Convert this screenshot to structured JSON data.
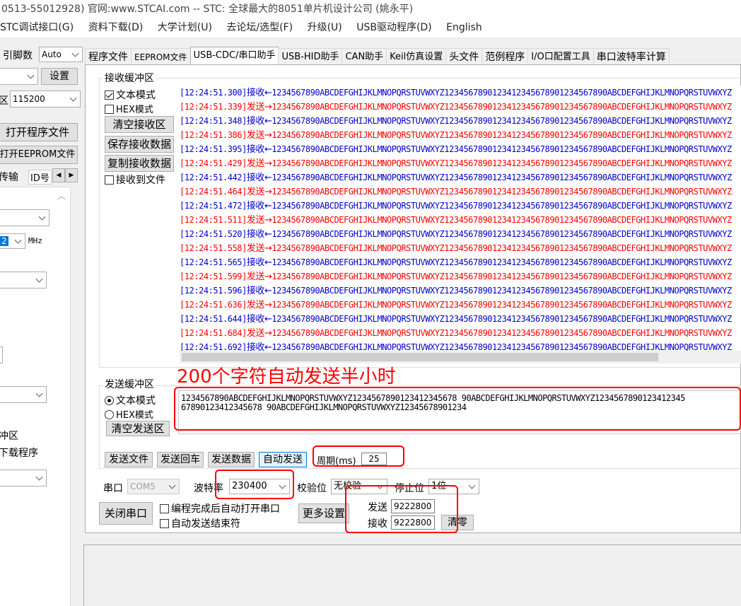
{
  "window": {
    "title": "0513-55012928) 官网:www.STCAI.com  -- STC: 全球最大的8051单片机设计公司 (姚永平)"
  },
  "menu": [
    "STC调试接口(G)",
    "资料下载(D)",
    "大学计划(U)",
    "去论坛/选型(F)",
    "升级(U)",
    "USB驱动程序(D)",
    "English"
  ],
  "left": {
    "pin_label": "引脚数",
    "pin_value": "Auto",
    "settings_button": "设置",
    "baud_prefix": "区",
    "baud_value": "115200",
    "open_program_button": "打开程序文件",
    "open_eeprom_button": "打开EEPROM文件",
    "subtab_transfer": "传输",
    "subtab_id": "ID号",
    "freq_value": "2",
    "freq_unit": "MHz",
    "item_zone": "冲区",
    "item_download": "下载程序"
  },
  "tabs": [
    "程序文件",
    "EEPROM文件",
    "USB-CDC/串口助手",
    "USB-HID助手",
    "CAN助手",
    "Keil仿真设置",
    "头文件",
    "范例程序",
    "I/O口配置工具",
    "串口波特率计算"
  ],
  "active_tab": 2,
  "receive": {
    "group_title": "接收缓冲区",
    "text_mode": "文本模式",
    "hex_mode": "HEX模式",
    "clear_button": "清空接收区",
    "save_button": "保存接收数据",
    "copy_button": "复制接收数据",
    "to_file": "接收到文件",
    "lines": [
      {
        "time": "[12:24:51.300]",
        "dir": "rx",
        "tag": "接收←",
        "data": "1234567890ABCDEFGHIJKLMNOPQRSTUVWXYZ1234567890123412345678901234567890ABCDEFGHIJKLMNOPQRSTUVWXYZ"
      },
      {
        "time": "[12:24:51.339]",
        "dir": "tx",
        "tag": "发送→",
        "data": "1234567890ABCDEFGHIJKLMNOPQRSTUVWXYZ1234567890123412345678901234567890ABCDEFGHIJKLMNOPQRSTUVWXYZ"
      },
      {
        "time": "[12:24:51.348]",
        "dir": "rx",
        "tag": "接收←",
        "data": "1234567890ABCDEFGHIJKLMNOPQRSTUVWXYZ1234567890123412345678901234567890ABCDEFGHIJKLMNOPQRSTUVWXYZ"
      },
      {
        "time": "[12:24:51.386]",
        "dir": "tx",
        "tag": "发送→",
        "data": "1234567890ABCDEFGHIJKLMNOPQRSTUVWXYZ1234567890123412345678901234567890ABCDEFGHIJKLMNOPQRSTUVWXYZ"
      },
      {
        "time": "[12:24:51.395]",
        "dir": "rx",
        "tag": "接收←",
        "data": "1234567890ABCDEFGHIJKLMNOPQRSTUVWXYZ1234567890123412345678901234567890ABCDEFGHIJKLMNOPQRSTUVWXYZ"
      },
      {
        "time": "[12:24:51.429]",
        "dir": "tx",
        "tag": "发送→",
        "data": "1234567890ABCDEFGHIJKLMNOPQRSTUVWXYZ1234567890123412345678901234567890ABCDEFGHIJKLMNOPQRSTUVWXYZ"
      },
      {
        "time": "[12:24:51.442]",
        "dir": "rx",
        "tag": "接收←",
        "data": "1234567890ABCDEFGHIJKLMNOPQRSTUVWXYZ1234567890123412345678901234567890ABCDEFGHIJKLMNOPQRSTUVWXYZ"
      },
      {
        "time": "[12:24:51.464]",
        "dir": "tx",
        "tag": "发送→",
        "data": "1234567890ABCDEFGHIJKLMNOPQRSTUVWXYZ1234567890123412345678901234567890ABCDEFGHIJKLMNOPQRSTUVWXYZ"
      },
      {
        "time": "[12:24:51.472]",
        "dir": "rx",
        "tag": "接收←",
        "data": "1234567890ABCDEFGHIJKLMNOPQRSTUVWXYZ1234567890123412345678901234567890ABCDEFGHIJKLMNOPQRSTUVWXYZ"
      },
      {
        "time": "[12:24:51.511]",
        "dir": "tx",
        "tag": "发送→",
        "data": "1234567890ABCDEFGHIJKLMNOPQRSTUVWXYZ1234567890123412345678901234567890ABCDEFGHIJKLMNOPQRSTUVWXYZ"
      },
      {
        "time": "[12:24:51.520]",
        "dir": "rx",
        "tag": "接收←",
        "data": "1234567890ABCDEFGHIJKLMNOPQRSTUVWXYZ1234567890123412345678901234567890ABCDEFGHIJKLMNOPQRSTUVWXYZ"
      },
      {
        "time": "[12:24:51.558]",
        "dir": "tx",
        "tag": "发送→",
        "data": "1234567890ABCDEFGHIJKLMNOPQRSTUVWXYZ1234567890123412345678901234567890ABCDEFGHIJKLMNOPQRSTUVWXYZ"
      },
      {
        "time": "[12:24:51.565]",
        "dir": "rx",
        "tag": "接收←",
        "data": "1234567890ABCDEFGHIJKLMNOPQRSTUVWXYZ1234567890123412345678901234567890ABCDEFGHIJKLMNOPQRSTUVWXYZ"
      },
      {
        "time": "[12:24:51.599]",
        "dir": "tx",
        "tag": "发送→",
        "data": "1234567890ABCDEFGHIJKLMNOPQRSTUVWXYZ1234567890123412345678901234567890ABCDEFGHIJKLMNOPQRSTUVWXYZ"
      },
      {
        "time": "[12:24:51.596]",
        "dir": "rx",
        "tag": "接收←",
        "data": "1234567890ABCDEFGHIJKLMNOPQRSTUVWXYZ1234567890123412345678901234567890ABCDEFGHIJKLMNOPQRSTUVWXYZ"
      },
      {
        "time": "[12:24:51.636]",
        "dir": "tx",
        "tag": "发送→",
        "data": "1234567890ABCDEFGHIJKLMNOPQRSTUVWXYZ1234567890123412345678901234567890ABCDEFGHIJKLMNOPQRSTUVWXYZ"
      },
      {
        "time": "[12:24:51.644]",
        "dir": "rx",
        "tag": "接收←",
        "data": "1234567890ABCDEFGHIJKLMNOPQRSTUVWXYZ1234567890123412345678901234567890ABCDEFGHIJKLMNOPQRSTUVWXYZ"
      },
      {
        "time": "[12:24:51.684]",
        "dir": "tx",
        "tag": "发送→",
        "data": "1234567890ABCDEFGHIJKLMNOPQRSTUVWXYZ1234567890123412345678901234567890ABCDEFGHIJKLMNOPQRSTUVWXYZ"
      },
      {
        "time": "[12:24:51.692]",
        "dir": "rx",
        "tag": "接收←",
        "data": "1234567890ABCDEFGHIJKLMNOPQRSTUVWXYZ1234567890123412345678901234567890ABCDEFGHIJKLMNOPQRSTUVWXYZ"
      }
    ],
    "colors": {
      "rx": "#0000cc",
      "tx": "#ff0000"
    }
  },
  "annotation": "200个字符自动发送半小时",
  "send": {
    "group_title": "发送缓冲区",
    "text_mode": "文本模式",
    "hex_mode": "HEX模式",
    "clear_button": "清空发送区",
    "content": "1234567890ABCDEFGHIJKLMNOPQRSTUVWXYZ12345678901234123456789 0ABCDEFGHIJKLMNOPQRSTUVWXYZ123456789012341234567890ABCDEFGHIJKLMNOPQRSTUVWXYZ12345678901234",
    "line1": "1234567890ABCDEFGHIJKLMNOPQRSTUVWXYZ1234567890123412345678 90ABCDEFGHIJKLMNOPQRSTUVWXYZ1234567890123412345",
    "line2": "67890123412345678 90ABCDEFGHIJKLMNOPQRSTUVWXYZ12345678901234",
    "send_file": "发送文件",
    "send_enter": "发送回车",
    "send_data": "发送数据",
    "auto_send": "自动发送",
    "period_label": "周期(ms)",
    "period_value": "25"
  },
  "port": {
    "port_label": "串口",
    "port_value": "COM5",
    "baud_label": "波特率",
    "baud_value": "230400",
    "parity_label": "校验位",
    "parity_value": "无校验",
    "stop_label": "停止位",
    "stop_value": "1位",
    "close_button": "关闭串口",
    "auto_open": "编程完成后自动打开串口",
    "auto_end": "自动发送结束符",
    "more_settings": "更多设置",
    "sent_label": "发送",
    "sent_value": "9222800",
    "recv_label": "接收",
    "recv_value": "9222800",
    "clear_count": "清零"
  },
  "accent_red": "#ff0000"
}
